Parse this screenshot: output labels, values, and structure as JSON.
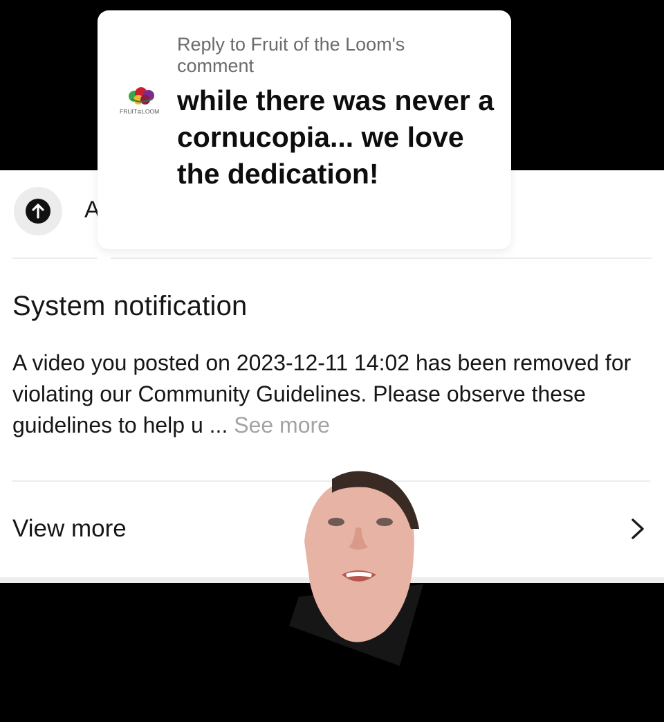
{
  "reply": {
    "header": "Reply to Fruit of the Loom's comment",
    "text": "while there was never a cornucopia... we love the dedication!",
    "logo_caption": "FRUIT≣LOOM",
    "logo_icon": "fruit-of-the-loom-logo"
  },
  "list": {
    "upload_icon": "arrow-up-circle-icon",
    "row_initial": "A"
  },
  "notification": {
    "title": "System notification",
    "body": "A video you posted on 2023-12-11 14:02 has been removed for violating our Community Guidelines. Please observe these guidelines to help u ...",
    "see_more": "See more",
    "view_more": "View more",
    "chevron_icon": "chevron-right-icon"
  },
  "colors": {
    "background": "#000000",
    "panel": "#ffffff",
    "text_primary": "#161616",
    "text_muted": "#a3a3a3",
    "reply_header": "#6b6b6b"
  }
}
